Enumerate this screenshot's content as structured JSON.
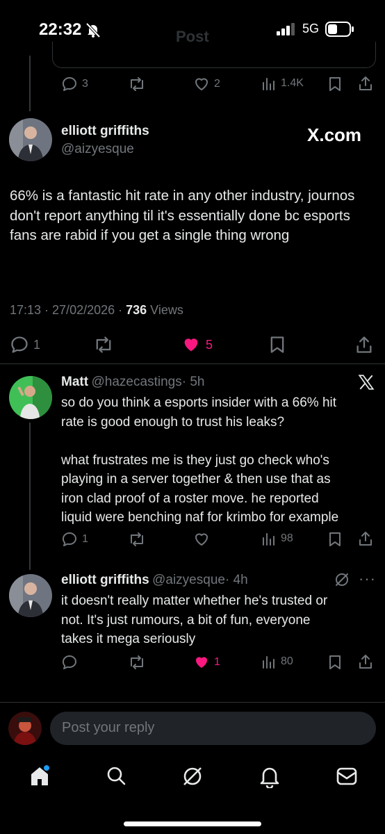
{
  "status_bar": {
    "time": "22:32",
    "network": "5G"
  },
  "header": {
    "title": "Post"
  },
  "top_post_actions": {
    "replies": "3",
    "likes": "2",
    "views": "1.4K"
  },
  "main_post": {
    "author_name": "elliott griffiths",
    "author_handle": "@aizyesque",
    "source": "X.com",
    "text": "66% is a fantastic hit rate in any other industry, journos don't report anything til it's essentially done bc esports fans are rabid if you get a single thing wrong",
    "timestamp": "17:13 · 27/02/2026 · ",
    "views_count": "736",
    "views_label": " Views",
    "replies": "1",
    "likes": "5",
    "like_color": "#f91880"
  },
  "reply_1": {
    "author_name": "Matt",
    "author_handle": "@hazecastings",
    "age": "· 5h",
    "line1": "so do you think a esports insider with a 66% hit",
    "line2": "rate is good enough to trust his leaks?",
    "line3": "what frustrates me is they just go check who's",
    "line4": "playing in a server together & then use that as",
    "line5": "iron clad proof of a roster move. he reported",
    "line6": "liquid were benching naf for krimbo for example",
    "replies": "1",
    "views": "98"
  },
  "reply_2": {
    "author_name": "elliott griffiths",
    "author_handle": "@aizyesque",
    "age": "· 4h",
    "line1": "it doesn't really matter whether he's trusted or",
    "line2": "not. It's just rumours, a bit of fun, everyone",
    "line3": "takes it mega seriously",
    "likes": "1",
    "views": "80"
  },
  "composer": {
    "placeholder": "Post your reply"
  },
  "icons": [
    "silent-bell-icon",
    "signal-icon",
    "battery-icon",
    "reply-icon",
    "repost-icon",
    "heart-icon",
    "views-icon",
    "bookmark-icon",
    "share-icon",
    "x-logo-icon",
    "grok-icon",
    "more-icon",
    "home-icon",
    "search-icon",
    "notifications-icon",
    "messages-icon"
  ],
  "colors": {
    "background": "#000000",
    "text": "#e7e9ea",
    "muted": "#71767b",
    "like": "#f91880",
    "accent": "#1d9bf0"
  }
}
